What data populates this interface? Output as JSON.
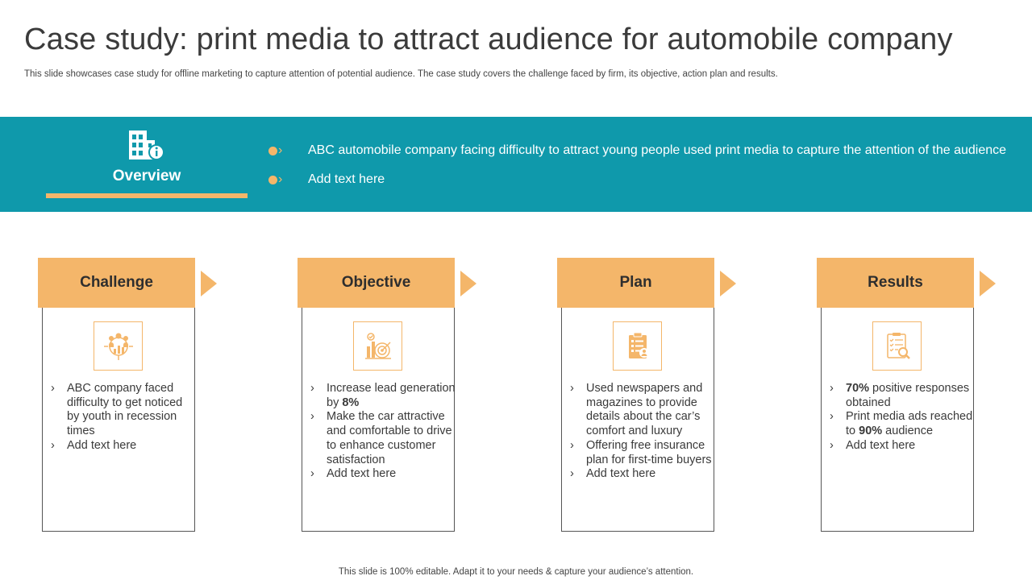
{
  "title": "Case study: print media to attract audience for automobile company",
  "subtitle": "This slide showcases case study for offline marketing to capture attention of potential audience. The case study covers the challenge faced by firm, its objective, action plan and results.",
  "overview": {
    "label": "Overview",
    "icon": "building-info-icon",
    "bullets": [
      "ABC automobile company facing difficulty to attract young people used print media to capture the attention  of the audience",
      "Add text here"
    ]
  },
  "cards": [
    {
      "title": "Challenge",
      "icon": "people-chart-icon",
      "items": [
        {
          "pre": "ABC company faced difficulty to get noticed by youth in recession times",
          "bold": "",
          "post": ""
        },
        {
          "pre": "Add text here",
          "bold": "",
          "post": ""
        }
      ]
    },
    {
      "title": "Objective",
      "icon": "target-chart-icon",
      "items": [
        {
          "pre": "Increase lead generation by ",
          "bold": "8%",
          "post": ""
        },
        {
          "pre": "Make the car attractive and comfortable to drive to enhance customer satisfaction",
          "bold": "",
          "post": ""
        },
        {
          "pre": "Add text here",
          "bold": "",
          "post": ""
        }
      ]
    },
    {
      "title": "Plan",
      "icon": "clipboard-user-icon",
      "items": [
        {
          "pre": "Used newspapers and magazines to provide details about the car’s comfort and luxury",
          "bold": "",
          "post": ""
        },
        {
          "pre": "Offering free insurance plan for first-time buyers",
          "bold": "",
          "post": ""
        },
        {
          "pre": "Add text here",
          "bold": "",
          "post": ""
        }
      ]
    },
    {
      "title": "Results",
      "icon": "report-search-icon",
      "items": [
        {
          "pre": "",
          "bold": "70%",
          "post": " positive responses obtained"
        },
        {
          "pre": "Print media ads reached to ",
          "bold": "90%",
          "post": " audience"
        },
        {
          "pre": "Add text here",
          "bold": "",
          "post": ""
        }
      ]
    }
  ],
  "footer": "This slide is 100% editable. Adapt it to your needs & capture your audience’s attention.",
  "colors": {
    "band": "#0f99ab",
    "accent": "#f4b66a"
  }
}
